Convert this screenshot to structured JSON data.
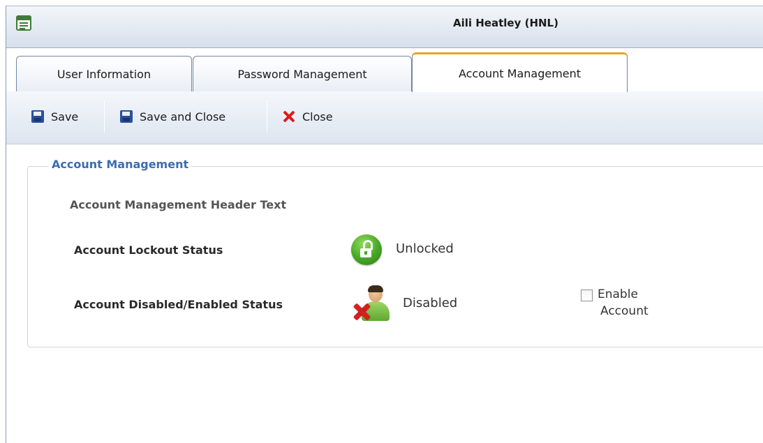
{
  "window": {
    "title": "Aili Heatley (HNL)",
    "icon": "form-icon"
  },
  "tabs": [
    {
      "label": "User Information",
      "active": false
    },
    {
      "label": "Password Management",
      "active": false
    },
    {
      "label": "Account Management",
      "active": true
    }
  ],
  "toolbar": {
    "save_label": "Save",
    "save_close_label": "Save and Close",
    "close_label": "Close",
    "icons": {
      "save": "floppy-disk-icon",
      "save_close": "floppy-disk-icon",
      "close": "red-x-icon"
    }
  },
  "section": {
    "legend": "Account Management",
    "header_text": "Account Management Header Text",
    "lockout": {
      "label": "Account Lockout Status",
      "status": "Unlocked",
      "icon": "unlocked-padlock-icon"
    },
    "disabled": {
      "label": "Account Disabled/Enabled Status",
      "status": "Disabled",
      "icon": "user-disabled-icon",
      "enable_checkbox": {
        "label_line1": "Enable",
        "label_line2": "Account",
        "checked": false
      }
    }
  },
  "colors": {
    "accent_tab": "#f0a020",
    "legend": "#3b6db0",
    "unlock_green": "#46a625",
    "close_red": "#e01818"
  }
}
